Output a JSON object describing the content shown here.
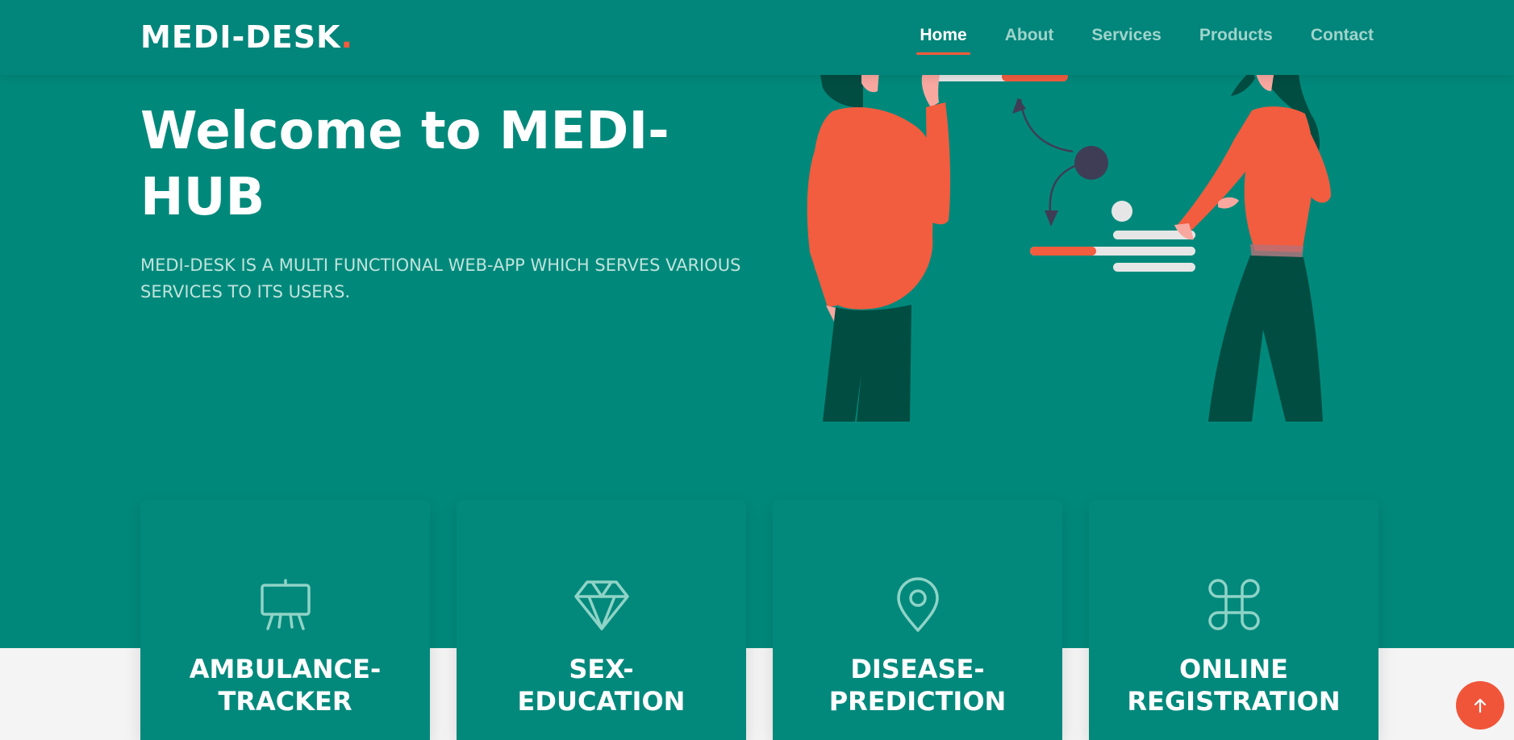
{
  "header": {
    "logo_text": "MEDI-DESK",
    "logo_dot": ".",
    "nav": [
      {
        "label": "Home",
        "active": true
      },
      {
        "label": "About"
      },
      {
        "label": "Services"
      },
      {
        "label": "Products"
      },
      {
        "label": "Contact"
      }
    ]
  },
  "hero": {
    "title": "Welcome to MEDI-HUB",
    "subtitle": "MEDI-DESK IS A MULTI FUNCTIONAL WEB-APP WHICH SERVES VARIOUS SERVICES TO ITS USERS."
  },
  "cards": [
    {
      "title_line1": "AMBULANCE-",
      "title_line2": "TRACKER",
      "icon": "easel-icon"
    },
    {
      "title_line1": "SEX-",
      "title_line2": "EDUCATION",
      "icon": "diamond-icon"
    },
    {
      "title_line1": "DISEASE-",
      "title_line2": "PREDICTION",
      "icon": "map-pin-icon"
    },
    {
      "title_line1": "ONLINE",
      "title_line2": "REGISTRATION",
      "icon": "command-icon"
    }
  ],
  "colors": {
    "primary": "#00897b",
    "accent": "#ff5a3c",
    "nav_inactive": "#9fd4cc",
    "dark_green": "#024d42"
  },
  "scroll_top": {
    "icon": "arrow-up-icon"
  }
}
